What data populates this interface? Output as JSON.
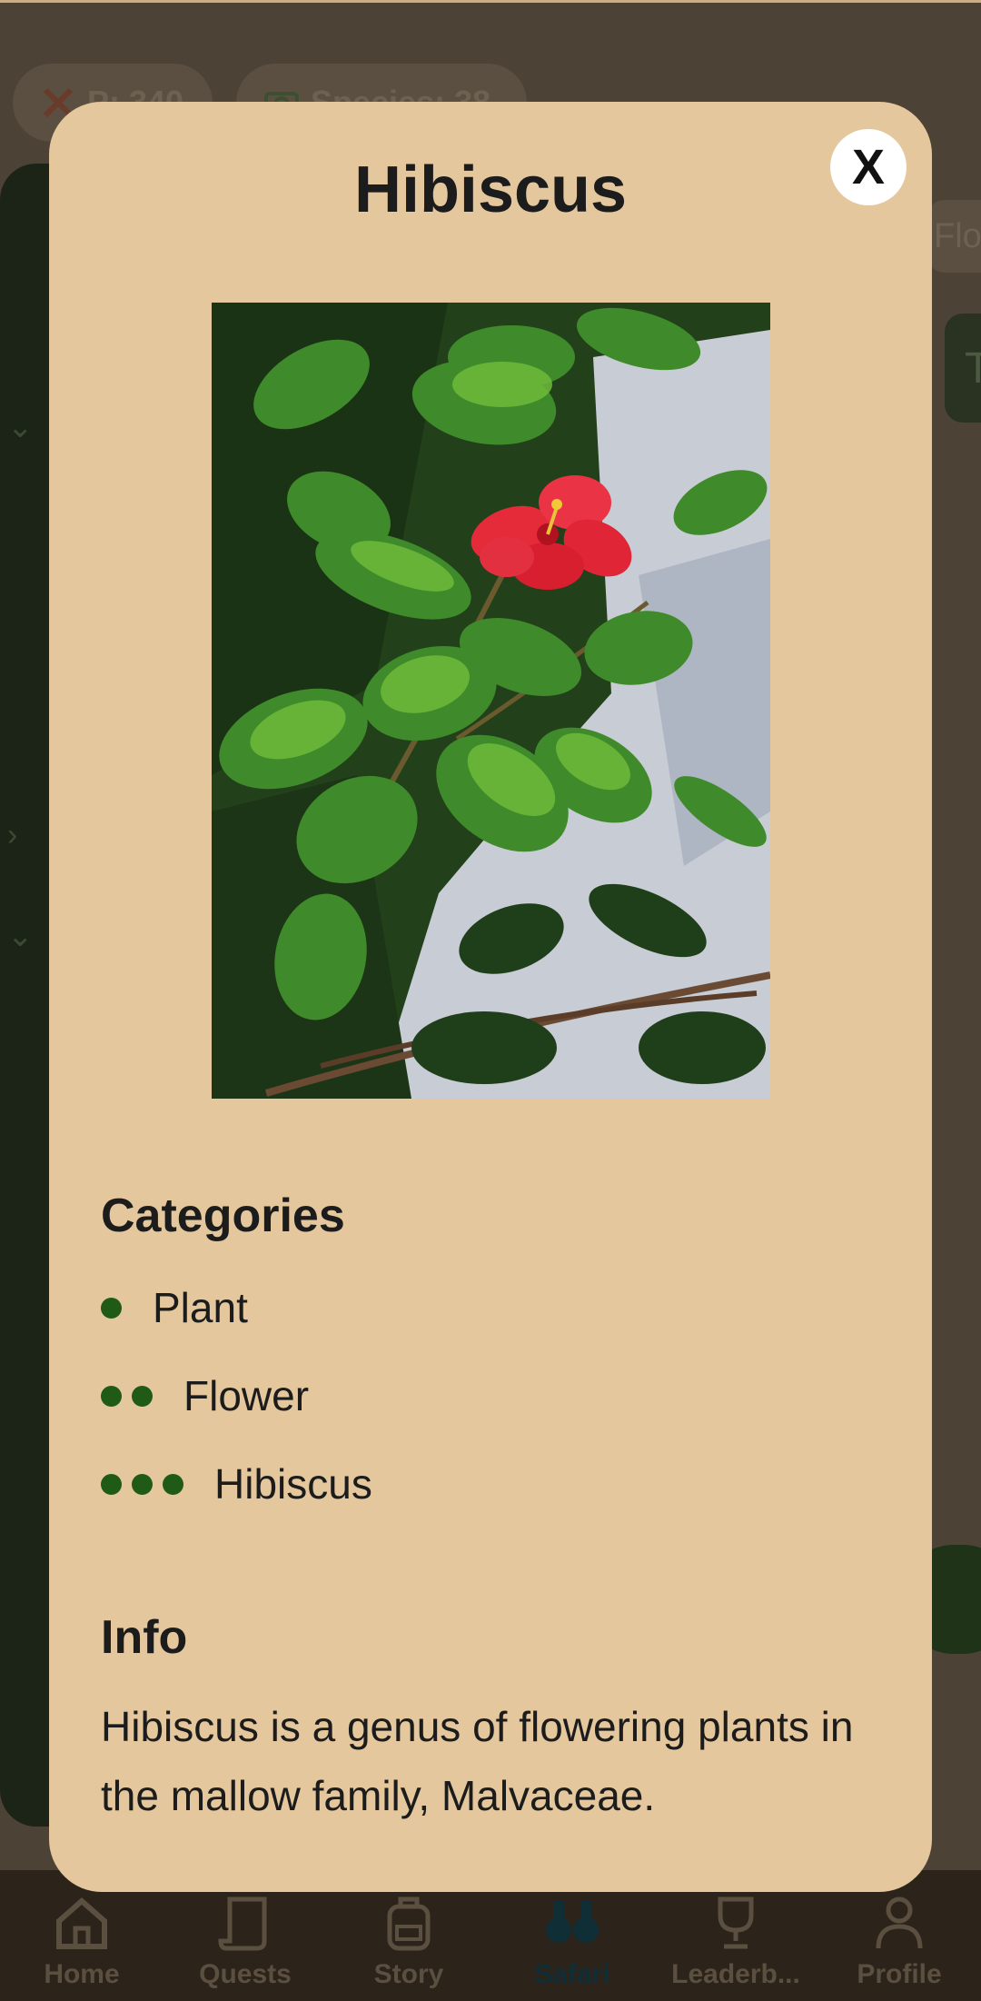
{
  "background": {
    "points_chip": "P: 340",
    "species_chip": "Species: 38",
    "right_tab_label": "Flo",
    "right_card_label": "T",
    "nav": [
      {
        "label": "Home",
        "icon": "home-icon"
      },
      {
        "label": "Quests",
        "icon": "scroll-icon"
      },
      {
        "label": "Story",
        "icon": "backpack-icon"
      },
      {
        "label": "Safari",
        "icon": "binoculars-icon"
      },
      {
        "label": "Leaderb...",
        "icon": "trophy-icon"
      },
      {
        "label": "Profile",
        "icon": "person-icon"
      }
    ]
  },
  "modal": {
    "title": "Hibiscus",
    "close_label": "X",
    "photo_subject": "red hibiscus flower among green leaves",
    "categories_heading": "Categories",
    "categories": [
      {
        "label": "Plant",
        "level": 1
      },
      {
        "label": "Flower",
        "level": 2
      },
      {
        "label": "Hibiscus",
        "level": 3
      }
    ],
    "info_heading": "Info",
    "info_text": "Hibiscus is a genus of flowering plants in the mallow family, Malvaceae."
  },
  "colors": {
    "modal_bg": "#e4c79c",
    "category_dot": "#1f5a16",
    "overlay_bg": "#4c4236"
  }
}
